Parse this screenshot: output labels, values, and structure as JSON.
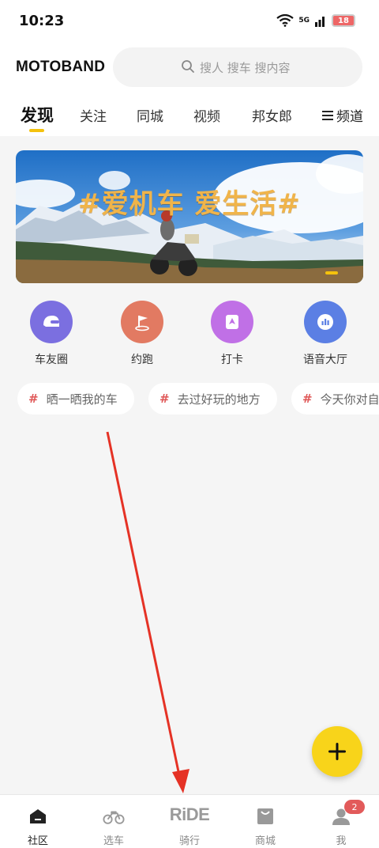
{
  "status_bar": {
    "time": "10:23",
    "network": "5G",
    "battery": "18"
  },
  "header": {
    "brand": "MOTOBAND",
    "search_placeholder": "搜人 搜车 搜内容"
  },
  "tabs": [
    {
      "label": "发现",
      "active": true
    },
    {
      "label": "关注"
    },
    {
      "label": "同城"
    },
    {
      "label": "视频"
    },
    {
      "label": "邦女郎"
    }
  ],
  "channel_label": "频道",
  "banner": {
    "title": "#爱机车 爱生活#"
  },
  "quick_actions": [
    {
      "label": "车友圈",
      "icon": "helmet-icon",
      "color": "#7b6fe0"
    },
    {
      "label": "约跑",
      "icon": "flag-icon",
      "color": "#e27a62"
    },
    {
      "label": "打卡",
      "icon": "checkin-icon",
      "color": "#c070e6"
    },
    {
      "label": "语音大厅",
      "icon": "voice-icon",
      "color": "#5b7fe4"
    }
  ],
  "topics": [
    {
      "label": "晒一晒我的车"
    },
    {
      "label": "去过好玩的地方"
    },
    {
      "label": "今天你对自"
    }
  ],
  "bottom_nav": [
    {
      "label": "社区",
      "icon": "home-icon",
      "active": true
    },
    {
      "label": "选车",
      "icon": "motorcycle-icon"
    },
    {
      "label": "骑行",
      "icon": "ride-logo",
      "logo_text": "RiDE"
    },
    {
      "label": "商城",
      "icon": "shop-bag-icon"
    },
    {
      "label": "我",
      "icon": "user-icon",
      "badge": "2"
    }
  ],
  "colors": {
    "accent": "#f4c20d",
    "fab": "#f8d41a",
    "annotation_arrow": "#e53225"
  }
}
